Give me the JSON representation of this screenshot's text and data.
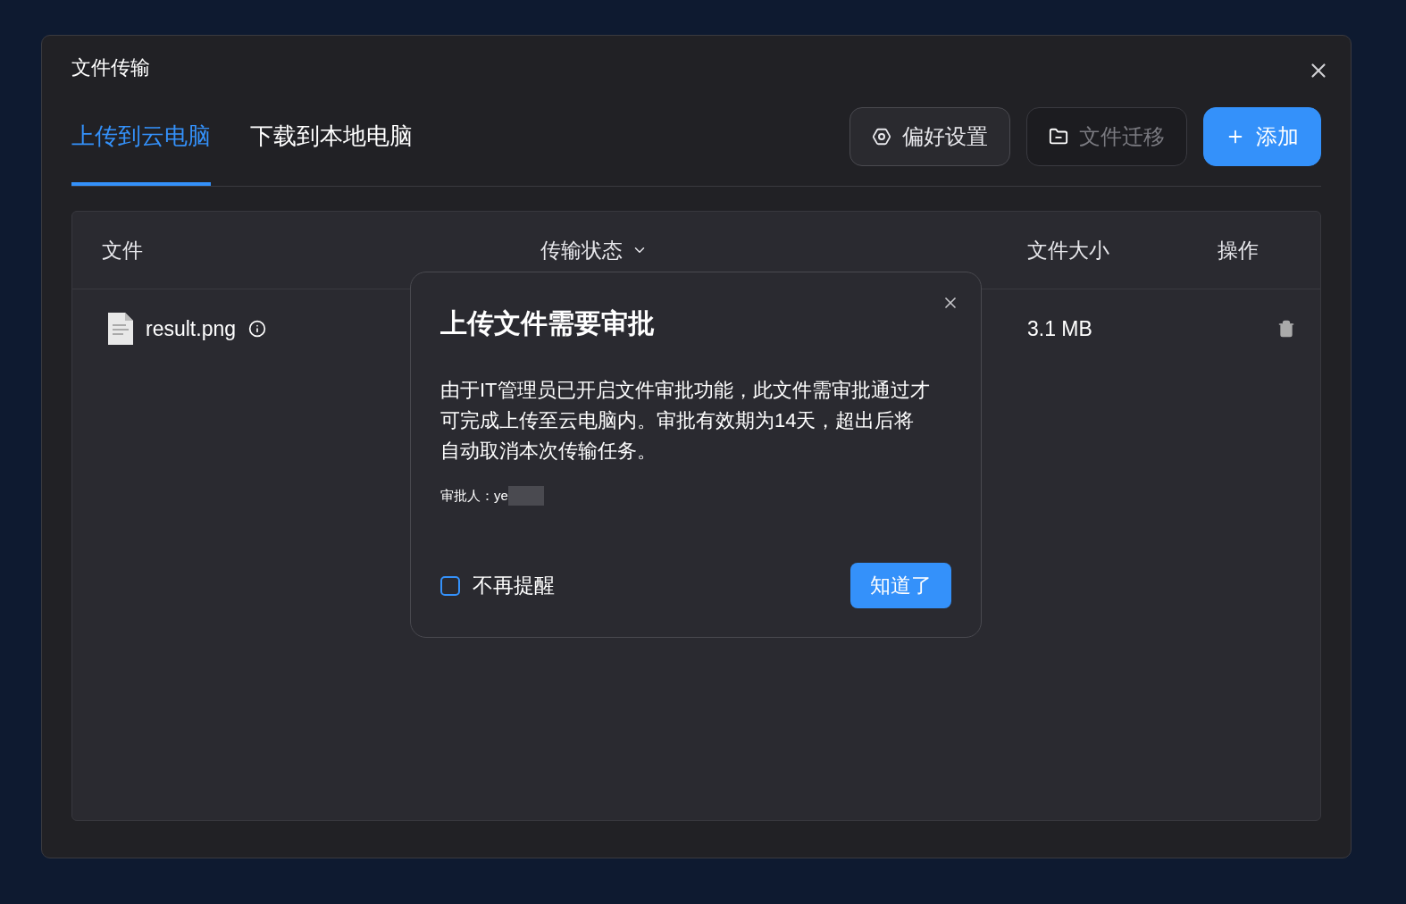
{
  "window": {
    "title": "文件传输"
  },
  "tabs": [
    {
      "label": "上传到云电脑",
      "selected": true
    },
    {
      "label": "下载到本地电脑",
      "selected": false
    }
  ],
  "toolbar": [
    {
      "kind": "settings",
      "label": "偏好设置",
      "disabled": false
    },
    {
      "kind": "folder",
      "label": "文件迁移",
      "disabled": true
    },
    {
      "kind": "add",
      "label": "添加",
      "disabled": false
    }
  ],
  "table": {
    "columns": [
      "文件",
      "传输状态",
      "文件大小",
      "操作"
    ],
    "rows": [
      {
        "name": "result.png",
        "size": "3.1 MB"
      }
    ]
  },
  "dialog": {
    "title": "上传文件需要审批",
    "message": "由于IT管理员已开启文件审批功能，此文件需审批通过才可完成上传至云电脑内。审批有效期为14天，超出后将自动取消本次传输任务。",
    "approver": "审批人：ye",
    "dont_remind": {
      "label": "不再提醒",
      "checked": false
    },
    "button": "知道了"
  }
}
